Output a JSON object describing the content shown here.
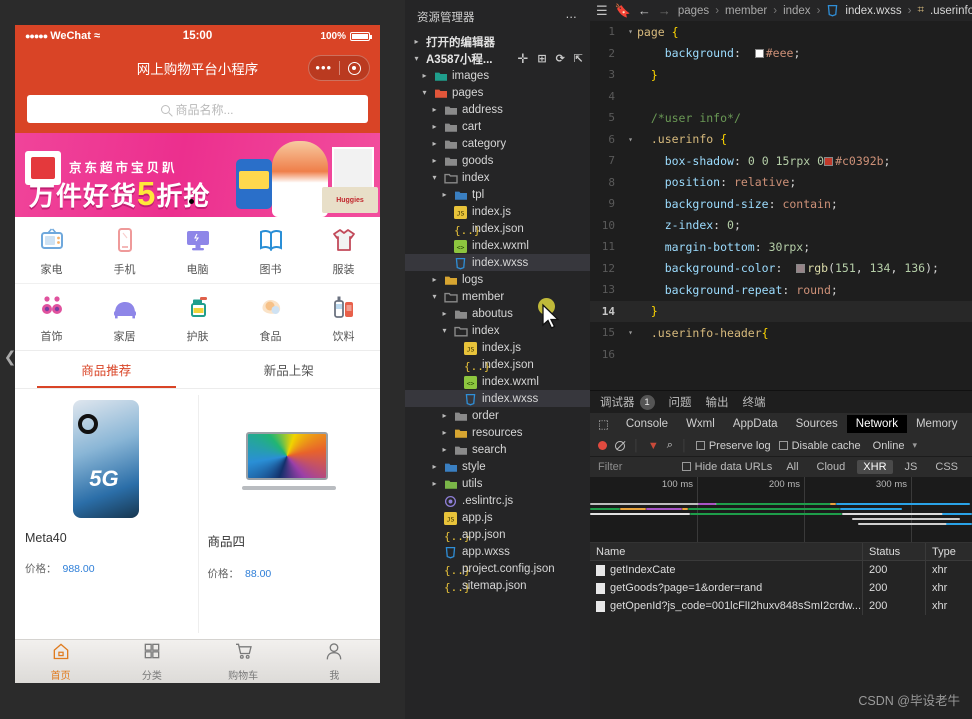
{
  "simulator": {
    "status": {
      "carrier": "WeChat",
      "signal_dots": "●●●●●",
      "wifi": "≈",
      "time": "15:00",
      "battery": "100%"
    },
    "navbar": {
      "title": "网上购物平台小程序",
      "capsule_menu": "•••"
    },
    "search": {
      "placeholder": "商品名称..."
    },
    "banner": {
      "brand": "京东超市宝贝趴",
      "headline_a": "万件好货",
      "headline_b": "5",
      "headline_c": "折抢",
      "box_label": "Huggies"
    },
    "categories_row1": [
      {
        "label": "家电",
        "icon": "tv-icon"
      },
      {
        "label": "手机",
        "icon": "phone-icon"
      },
      {
        "label": "电脑",
        "icon": "monitor-icon"
      },
      {
        "label": "图书",
        "icon": "book-icon"
      },
      {
        "label": "服装",
        "icon": "shirt-icon"
      }
    ],
    "categories_row2": [
      {
        "label": "首饰",
        "icon": "jewelry-icon"
      },
      {
        "label": "家居",
        "icon": "sofa-icon"
      },
      {
        "label": "护肤",
        "icon": "skincare-icon"
      },
      {
        "label": "食品",
        "icon": "food-icon"
      },
      {
        "label": "饮料",
        "icon": "drink-icon"
      }
    ],
    "product_tabs": [
      {
        "label": "商品推荐",
        "active": true
      },
      {
        "label": "新品上架",
        "active": false
      }
    ],
    "products": [
      {
        "title": "Meta40",
        "price_label": "价格：",
        "price": "988.00"
      },
      {
        "title": "商品四",
        "price_label": "价格：",
        "price": "88.00"
      }
    ],
    "tabbar": [
      {
        "label": "首页",
        "icon": "home-icon",
        "active": true
      },
      {
        "label": "分类",
        "icon": "grid-icon",
        "active": false
      },
      {
        "label": "购物车",
        "icon": "cart-icon",
        "active": false
      },
      {
        "label": "我",
        "icon": "user-icon",
        "active": false
      }
    ]
  },
  "explorer": {
    "title": "资源管理器",
    "more": "⋯",
    "open_editors": "打开的编辑器",
    "project": "A3587小程...",
    "actions": [
      "new-file-icon",
      "new-folder-icon",
      "refresh-icon",
      "collapse-all-icon"
    ],
    "tree": [
      {
        "depth": 1,
        "label": "images",
        "type": "folder",
        "arrow": "▸",
        "color": "#1f9e8c"
      },
      {
        "depth": 1,
        "label": "pages",
        "type": "folder",
        "arrow": "▾",
        "color": "#e2563a"
      },
      {
        "depth": 2,
        "label": "address",
        "type": "folder",
        "arrow": "▸",
        "color": "#8a8a8a"
      },
      {
        "depth": 2,
        "label": "cart",
        "type": "folder",
        "arrow": "▸",
        "color": "#8a8a8a"
      },
      {
        "depth": 2,
        "label": "category",
        "type": "folder",
        "arrow": "▸",
        "color": "#8a8a8a"
      },
      {
        "depth": 2,
        "label": "goods",
        "type": "folder",
        "arrow": "▸",
        "color": "#8a8a8a"
      },
      {
        "depth": 2,
        "label": "index",
        "type": "folder-open",
        "arrow": "▾",
        "color": "#8a8a8a"
      },
      {
        "depth": 3,
        "label": "tpl",
        "type": "folder",
        "arrow": "▸",
        "color": "#3a7fc1"
      },
      {
        "depth": 3,
        "label": "index.js",
        "type": "js",
        "arrow": ""
      },
      {
        "depth": 3,
        "label": "index.json",
        "type": "json",
        "arrow": ""
      },
      {
        "depth": 3,
        "label": "index.wxml",
        "type": "wxml",
        "arrow": ""
      },
      {
        "depth": 3,
        "label": "index.wxss",
        "type": "wxss",
        "arrow": "",
        "selected": true,
        "hover": true
      },
      {
        "depth": 2,
        "label": "logs",
        "type": "folder",
        "arrow": "▸",
        "color": "#d7a531"
      },
      {
        "depth": 2,
        "label": "member",
        "type": "folder-open",
        "arrow": "▾",
        "color": "#8a8a8a"
      },
      {
        "depth": 3,
        "label": "aboutus",
        "type": "folder",
        "arrow": "▸",
        "color": "#8a8a8a"
      },
      {
        "depth": 3,
        "label": "index",
        "type": "folder-open",
        "arrow": "▾",
        "color": "#8a8a8a"
      },
      {
        "depth": 4,
        "label": "index.js",
        "type": "js",
        "arrow": ""
      },
      {
        "depth": 4,
        "label": "index.json",
        "type": "json",
        "arrow": ""
      },
      {
        "depth": 4,
        "label": "index.wxml",
        "type": "wxml",
        "arrow": ""
      },
      {
        "depth": 4,
        "label": "index.wxss",
        "type": "wxss",
        "arrow": "",
        "selected": true
      },
      {
        "depth": 3,
        "label": "order",
        "type": "folder",
        "arrow": "▸",
        "color": "#8a8a8a"
      },
      {
        "depth": 3,
        "label": "resources",
        "type": "folder",
        "arrow": "▸",
        "color": "#d7a531"
      },
      {
        "depth": 3,
        "label": "search",
        "type": "folder",
        "arrow": "▸",
        "color": "#8a8a8a"
      },
      {
        "depth": 2,
        "label": "style",
        "type": "folder",
        "arrow": "▸",
        "color": "#3a7fc1"
      },
      {
        "depth": 2,
        "label": "utils",
        "type": "folder",
        "arrow": "▸",
        "color": "#7ab648"
      },
      {
        "depth": 2,
        "label": ".eslintrc.js",
        "type": "eslint",
        "arrow": ""
      },
      {
        "depth": 2,
        "label": "app.js",
        "type": "js",
        "arrow": ""
      },
      {
        "depth": 2,
        "label": "app.json",
        "type": "json",
        "arrow": ""
      },
      {
        "depth": 2,
        "label": "app.wxss",
        "type": "wxss",
        "arrow": ""
      },
      {
        "depth": 2,
        "label": "project.config.json",
        "type": "json",
        "arrow": ""
      },
      {
        "depth": 2,
        "label": "sitemap.json",
        "type": "json",
        "arrow": ""
      }
    ]
  },
  "editor": {
    "breadcrumb": [
      "pages",
      "member",
      "index",
      "index.wxss",
      ".userinfo"
    ],
    "nav_icons": [
      "menu-icon",
      "bookmark-icon",
      "back-arrow-icon",
      "forward-arrow-icon"
    ],
    "lines": [
      {
        "n": "1",
        "fold": "▾",
        "html": "<span class='k-sel'>page</span> <span class='k-br'>{</span>"
      },
      {
        "n": "2",
        "fold": "",
        "html": "    <span class='k-prop'>background</span><span class='k-punc'>:</span>  <i class='sw' style='background:#fff'></i><span class='k-val'>#eee</span><span class='k-punc'>;</span>"
      },
      {
        "n": "3",
        "fold": "",
        "html": "  <span class='k-br'>}</span>"
      },
      {
        "n": "4",
        "fold": "",
        "html": ""
      },
      {
        "n": "5",
        "fold": "",
        "html": "  <span class='k-com'>/*user info*/</span>"
      },
      {
        "n": "6",
        "fold": "▾",
        "html": "  <span class='k-sel'>.userinfo</span> <span class='k-br'>{</span>"
      },
      {
        "n": "7",
        "fold": "",
        "html": "    <span class='k-prop'>box-shadow</span><span class='k-punc'>:</span> <span class='k-num'>0</span> <span class='k-num'>0</span> <span class='k-num'>15rpx</span> <span class='k-num'>0</span><i class='sw' style='background:#c0392b'></i><span class='k-val'>#c0392b</span><span class='k-punc'>;</span>"
      },
      {
        "n": "8",
        "fold": "",
        "html": "    <span class='k-prop'>position</span><span class='k-punc'>:</span> <span class='k-val'>relative</span><span class='k-punc'>;</span>"
      },
      {
        "n": "9",
        "fold": "",
        "html": "    <span class='k-prop'>background-size</span><span class='k-punc'>:</span> <span class='k-val'>contain</span><span class='k-punc'>;</span>"
      },
      {
        "n": "10",
        "fold": "",
        "html": "    <span class='k-prop'>z-index</span><span class='k-punc'>:</span> <span class='k-num'>0</span><span class='k-punc'>;</span>"
      },
      {
        "n": "11",
        "fold": "",
        "html": "    <span class='k-prop'>margin-bottom</span><span class='k-punc'>:</span> <span class='k-num'>30rpx</span><span class='k-punc'>;</span>"
      },
      {
        "n": "12",
        "fold": "",
        "html": "    <span class='k-prop'>background-color</span><span class='k-punc'>:</span>  <i class='sw' style='background:#978488'></i><span class='k-fn'>rgb</span><span class='k-punc'>(</span><span class='k-num'>151</span><span class='k-punc'>,</span> <span class='k-num'>134</span><span class='k-punc'>,</span> <span class='k-num'>136</span><span class='k-punc'>)</span><span class='k-punc'>;</span>"
      },
      {
        "n": "13",
        "fold": "",
        "html": "    <span class='k-prop'>background-repeat</span><span class='k-punc'>:</span> <span class='k-val'>round</span><span class='k-punc'>;</span>"
      },
      {
        "n": "14",
        "fold": "",
        "html": "  <span class='k-br'>}</span>",
        "active": true
      },
      {
        "n": "15",
        "fold": "▾",
        "html": "  <span class='k-sel'>.userinfo-header</span><span class='k-br'>{</span>"
      },
      {
        "n": "16",
        "fold": "",
        "html": ""
      }
    ]
  },
  "devtools": {
    "panels": [
      {
        "label": "调试器",
        "badge": "1"
      },
      {
        "label": "问题",
        "badge": ""
      },
      {
        "label": "输出",
        "badge": ""
      },
      {
        "label": "终端",
        "badge": ""
      }
    ],
    "tabs": [
      {
        "label": "Console",
        "active": false
      },
      {
        "label": "Wxml",
        "active": false
      },
      {
        "label": "AppData",
        "active": false
      },
      {
        "label": "Sources",
        "active": false
      },
      {
        "label": "Network",
        "active": true
      },
      {
        "label": "Memory",
        "active": false
      }
    ],
    "controls": {
      "record": "record-icon",
      "clear": "clear-icon",
      "filter": "filter-icon",
      "search": "search-icon",
      "preserve_log": "Preserve log",
      "disable_cache": "Disable cache",
      "throttle": "Online",
      "throttle_caret": "▾"
    },
    "filterbar": {
      "placeholder": "Filter",
      "hide_data_urls": "Hide data URLs",
      "types": [
        {
          "label": "All",
          "active": false
        },
        {
          "label": "Cloud",
          "active": false
        },
        {
          "label": "XHR",
          "active": true
        },
        {
          "label": "JS",
          "active": false
        },
        {
          "label": "CSS",
          "active": false
        }
      ]
    },
    "timeline": {
      "ticks": [
        "100 ms",
        "200 ms",
        "300 ms"
      ]
    },
    "table": {
      "headers": [
        "Name",
        "Status",
        "Type"
      ],
      "rows": [
        {
          "name": "getIndexCate",
          "status": "200",
          "type": "xhr"
        },
        {
          "name": "getGoods?page=1&order=rand",
          "status": "200",
          "type": "xhr"
        },
        {
          "name": "getOpenId?js_code=001lcFlI2huxv848sSmI2crdw...",
          "status": "200",
          "type": "xhr"
        }
      ]
    }
  },
  "watermark": "CSDN @毕设老牛",
  "colors": {
    "wechat_red": "#d94426",
    "banner_pink": "#ec2f8e",
    "price_blue": "#2f7fd8",
    "accent_orange": "#e07b1e"
  }
}
